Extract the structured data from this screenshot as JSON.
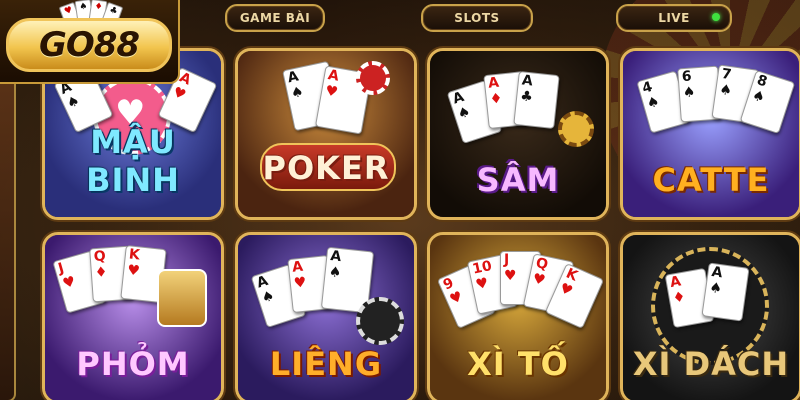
{
  "brand": {
    "logo_text": "GO88"
  },
  "nav": {
    "tabs": [
      {
        "label": "GAME BÀI",
        "active": true
      },
      {
        "label": "SLOTS",
        "active": false
      },
      {
        "label": "LIVE",
        "active": false,
        "indicator": "green-dot"
      }
    ]
  },
  "games": [
    {
      "title": "MẬU BINH",
      "icon": "poker-chip-heart"
    },
    {
      "title": "POKER",
      "icon": "aces-cards"
    },
    {
      "title": "SÂM",
      "icon": "aces-cards"
    },
    {
      "title": "CATTE",
      "icon": "spade-cards"
    },
    {
      "title": "PHỎM",
      "icon": "face-cards"
    },
    {
      "title": "LIÊNG",
      "icon": "aces-cards"
    },
    {
      "title": "XÌ TỐ",
      "icon": "fan-of-cards"
    },
    {
      "title": "XÌ DÁCH",
      "icon": "poker-chip-aces"
    }
  ],
  "colors": {
    "frame_gold": "#e0b45a",
    "live_indicator": "#3fe03f"
  }
}
